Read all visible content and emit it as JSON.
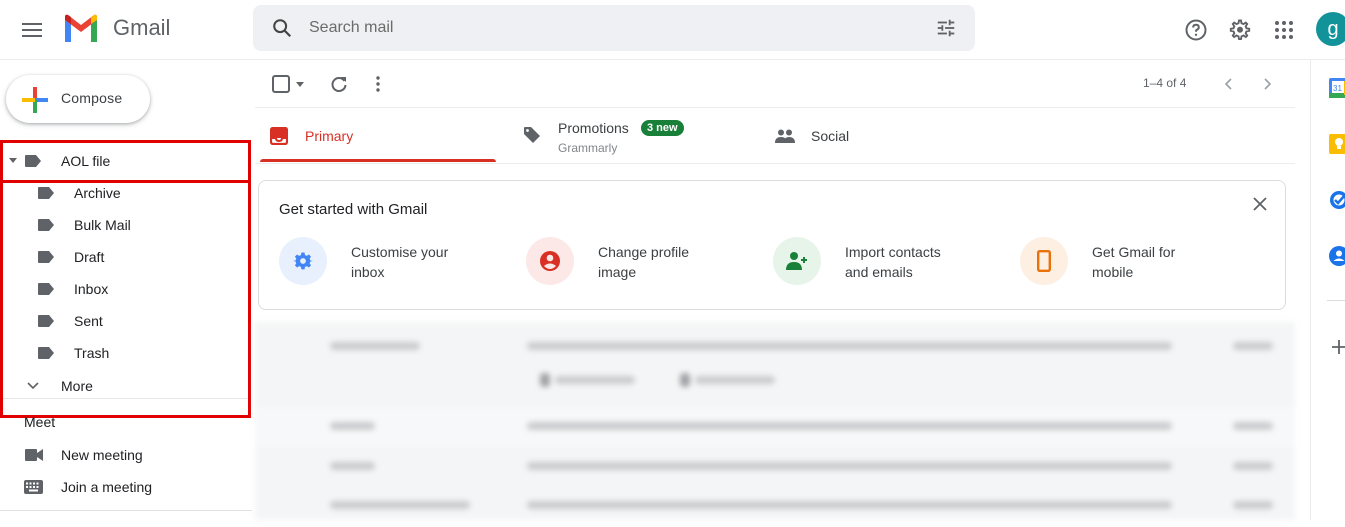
{
  "header": {
    "menu_icon": "hamburger-menu-icon",
    "brand": "Gmail",
    "search": {
      "placeholder": "Search mail",
      "value": ""
    },
    "avatar_initial": "g",
    "icons": [
      "help-icon",
      "settings-icon",
      "apps-grid-icon"
    ]
  },
  "sidebar": {
    "compose_label": "Compose",
    "parent_label": {
      "label": "AOL file",
      "expanded": true
    },
    "child_labels": [
      "Archive",
      "Bulk Mail",
      "Draft",
      "Inbox",
      "Sent",
      "Trash"
    ],
    "more_label": "More",
    "meet": {
      "title": "Meet",
      "items": [
        {
          "label": "New meeting",
          "icon": "video-camera-icon"
        },
        {
          "label": "Join a meeting",
          "icon": "keyboard-icon"
        }
      ]
    }
  },
  "toolbar": {
    "pager": "1–4 of 4"
  },
  "tabs": [
    {
      "label": "Primary",
      "active": true,
      "color": "#d93025"
    },
    {
      "label": "Promotions",
      "subtitle": "Grammarly",
      "badge": "3 new",
      "badge_color": "#188038"
    },
    {
      "label": "Social"
    }
  ],
  "get_started": {
    "title": "Get started with Gmail",
    "items": [
      {
        "line1": "Customise your",
        "line2": "inbox",
        "icon": "gear-icon",
        "color": "#4285f4",
        "bg": "#e8f0fe"
      },
      {
        "line1": "Change profile",
        "line2": "image",
        "icon": "account-circle-icon",
        "color": "#d93025",
        "bg": "#fce8e6"
      },
      {
        "line1": "Import contacts",
        "line2": "and emails",
        "icon": "person-add-icon",
        "color": "#188038",
        "bg": "#e6f4ea"
      },
      {
        "line1": "Get Gmail for",
        "line2": "mobile",
        "icon": "smartphone-icon",
        "color": "#e8710a",
        "bg": "#feefe3"
      }
    ]
  },
  "right_panel": {
    "apps": [
      "calendar-icon",
      "keep-icon",
      "tasks-icon",
      "contacts-icon",
      "add-addon-icon"
    ]
  },
  "highlight_color": "#e00000"
}
